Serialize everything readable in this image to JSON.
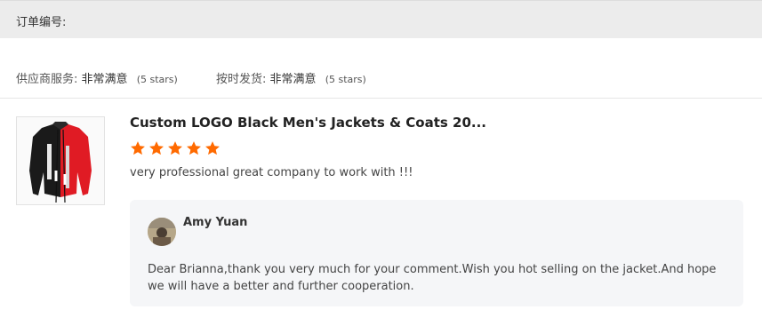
{
  "order": {
    "label": "订单编号:"
  },
  "ratings": [
    {
      "key": "供应商服务:",
      "value": "非常满意",
      "stars_text": "(5 stars)",
      "score": 5
    },
    {
      "key": "按时发货:",
      "value": "非常满意",
      "stars_text": "(5 stars)",
      "score": 5
    }
  ],
  "review": {
    "product_title": "Custom LOGO Black Men's Jackets & Coats 20...",
    "star_rating": 5,
    "star_color": "#ff6a00",
    "comment": "very professional great company to work with !!!",
    "product_image_icon": "jacket-image",
    "reply": {
      "author": "Amy Yuan",
      "text": "Dear Brianna,thank you very much for your comment.Wish you hot selling on the jacket.And hope we will have a better and further cooperation."
    }
  }
}
